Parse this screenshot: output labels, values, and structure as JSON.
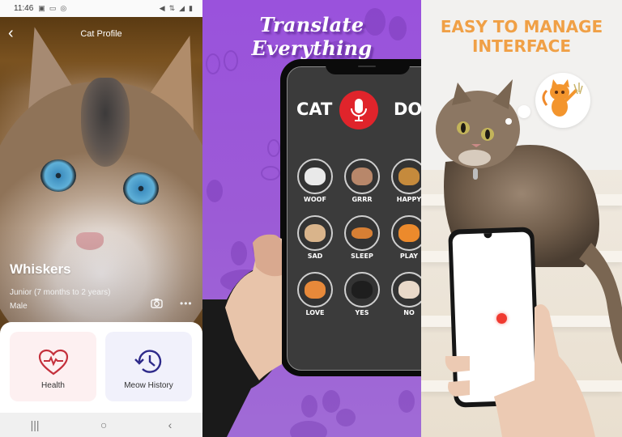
{
  "panel1": {
    "status_bar": {
      "time": "11:46",
      "left_icons": [
        "message-icon",
        "image-icon",
        "wifi-hotspot-icon"
      ],
      "right_icons": [
        "mute-icon",
        "data-icon",
        "signal-icon",
        "battery-icon"
      ]
    },
    "app_bar": {
      "title": "Cat Profile",
      "back_icon": "chevron-left-icon"
    },
    "profile": {
      "name": "Whiskers",
      "age_group": "Junior (7 months to 2 years)",
      "sex": "Male",
      "camera_icon": "camera-icon",
      "more_icon": "more-icon"
    },
    "cards": [
      {
        "label": "Health",
        "icon": "heart-pulse-icon",
        "color": "#c4303c"
      },
      {
        "label": "Meow History",
        "icon": "history-clock-icon",
        "color": "#2e2a8a"
      }
    ],
    "nav_bar": {
      "recents": "|||",
      "home": "○",
      "back": "‹"
    }
  },
  "panel2": {
    "title": "Translate Everything",
    "from_label": "CAT",
    "to_label": "DOG",
    "mic_icon": "microphone-icon",
    "mic_color": "#e0242b",
    "sounds": [
      {
        "label": "WOOF"
      },
      {
        "label": "GRRR"
      },
      {
        "label": "HAPPY"
      },
      {
        "label": "SAD"
      },
      {
        "label": "SLEEP"
      },
      {
        "label": "PLAY"
      },
      {
        "label": "LOVE"
      },
      {
        "label": "YES"
      },
      {
        "label": "NO"
      }
    ],
    "background_color": "#9b5bd6"
  },
  "panel3": {
    "title_line1": "EASY TO MANAGE",
    "title_line2": "INTERFACE",
    "title_color": "#f0a046",
    "laser_dot_color": "#f03a30"
  }
}
